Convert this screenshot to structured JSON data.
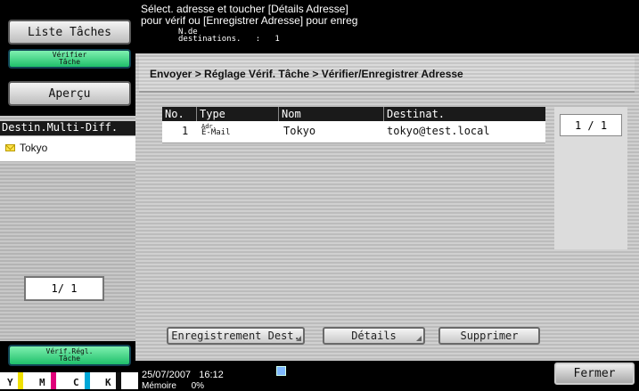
{
  "left_panel": {
    "task_list_label": "Liste Tâches",
    "verify_task_label_1": "Vérifier",
    "verify_task_label_2": "Tâche",
    "preview_label": "Aperçu",
    "multi_dest_header": "Destin.Multi-Diff.",
    "multi_dest_item": "Tokyo",
    "page_indicator": "1/ 1",
    "verify_settings_label_1": "Vérif.Régl.",
    "verify_settings_label_2": "Tâche",
    "toner": [
      {
        "label": "Y",
        "color": "#f0e000"
      },
      {
        "label": "M",
        "color": "#e0007a"
      },
      {
        "label": "C",
        "color": "#00a8d8"
      },
      {
        "label": "K",
        "color": "#111111"
      }
    ]
  },
  "header": {
    "line1": "Sélect. adresse et toucher [Détails Adresse]",
    "line2": "pour vérif ou [Enregistrer Adresse] pour enreg",
    "dest_count_label_1": "N.de",
    "dest_count_label_2": "destinations.",
    "dest_count_sep": ":",
    "dest_count_value": "1"
  },
  "breadcrumb": "Envoyer > Réglage Vérif. Tâche > Vérifier/Enregistrer Adresse",
  "table": {
    "headers": [
      "No.",
      "Type",
      "Nom",
      "Destinat."
    ],
    "rows": [
      {
        "no": "1",
        "type_line1": "Adr.",
        "type_line2": "E-Mail",
        "name": "Tokyo",
        "dest": "tokyo@test.local"
      }
    ]
  },
  "pager": {
    "page": "1 / 1"
  },
  "buttons": {
    "register": "Enregistrement Dest.",
    "details": "Détails",
    "delete": "Supprimer",
    "close": "Fermer"
  },
  "status": {
    "date": "25/07/2007",
    "time": "16:12",
    "memory_label": "Mémoire",
    "memory_value": "0%"
  }
}
